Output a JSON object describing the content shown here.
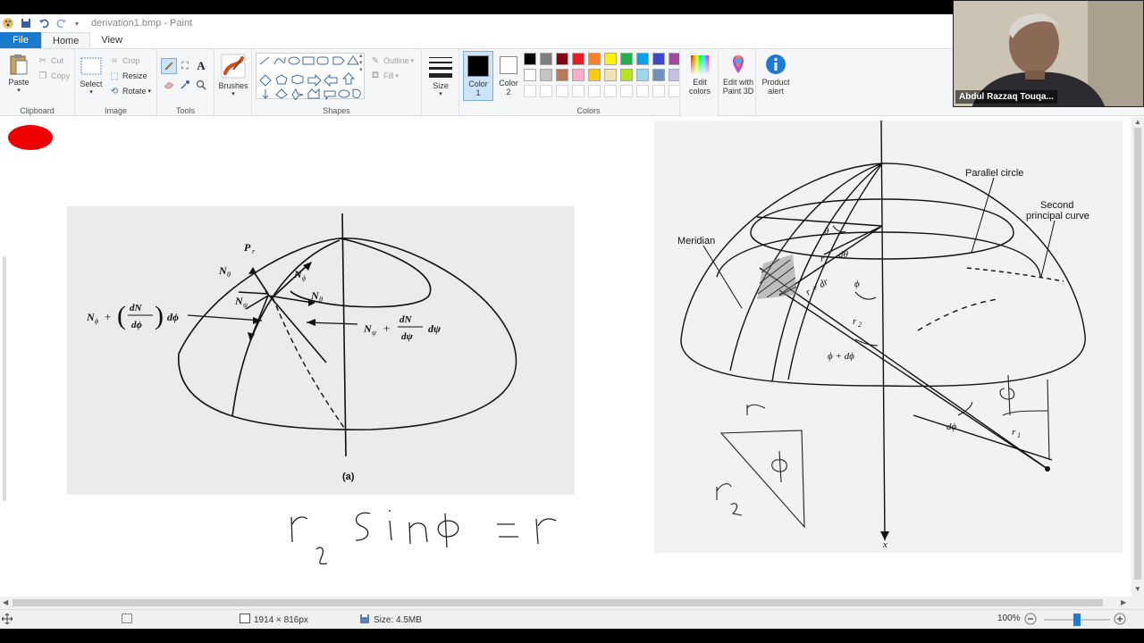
{
  "window": {
    "title": "derivation1.bmp - Paint"
  },
  "tabs": {
    "file": "File",
    "home": "Home",
    "view": "View"
  },
  "ribbon": {
    "clipboard": {
      "label": "Clipboard",
      "paste": "Paste",
      "cut": "Cut",
      "copy": "Copy"
    },
    "image": {
      "label": "Image",
      "select": "Select",
      "crop": "Crop",
      "resize": "Resize",
      "rotate": "Rotate"
    },
    "tools": {
      "label": "Tools"
    },
    "brushes": {
      "label": "Brushes"
    },
    "shapes": {
      "label": "Shapes",
      "outline": "Outline",
      "fill": "Fill"
    },
    "size": {
      "label": "Size"
    },
    "colors": {
      "label": "Colors",
      "color1": "Color 1",
      "color2": "Color 2",
      "edit_colors": "Edit colors",
      "palette_row1": [
        "#000000",
        "#7f7f7f",
        "#880015",
        "#ed1c24",
        "#ff7f27",
        "#fff200",
        "#22b14c",
        "#00a2e8",
        "#3f48cc",
        "#a349a4"
      ],
      "palette_row2": [
        "#ffffff",
        "#c3c3c3",
        "#b97a57",
        "#ffaec9",
        "#ffc90e",
        "#efe4b0",
        "#b5e61d",
        "#99d9ea",
        "#7092be",
        "#c8bfe7"
      ],
      "color1_value": "#000000",
      "color2_value": "#ffffff"
    },
    "paint3d": {
      "label": "Edit with Paint 3D"
    },
    "product_alert": {
      "label": "Product alert"
    }
  },
  "canvas": {
    "left_figure": {
      "labels": {
        "pr": "P",
        "pr_sub": "r",
        "ntheta_top": "N",
        "ntheta_sub": "θ",
        "nphi": "N",
        "nphi_sub": "ϕ",
        "ntheta2": "N",
        "ntheta2_sub": "θ",
        "npsi": "N",
        "npsi_sub": "ψ",
        "left_eq_a": "N",
        "left_eq_b": "+",
        "left_eq_num": "dN",
        "left_eq_den": "dϕ",
        "left_eq_tail": "dϕ",
        "right_eq_a": "N",
        "right_eq_b": "+",
        "right_eq_num": "dN",
        "right_eq_den": "dψ",
        "right_eq_tail": "dψ",
        "caption": "(a)"
      }
    },
    "right_figure": {
      "labels": {
        "parallel_circle": "Parallel circle",
        "second_principal_1": "Second",
        "second_principal_2": "principal curve",
        "meridian": "Meridian",
        "theta": "θ",
        "dtheta": "dθ",
        "r": "r",
        "r_dr": "r + dr",
        "phi": "ϕ",
        "r2": "r",
        "r2_sub": "2",
        "phi_dphi": "ϕ + dϕ",
        "dphi": "dϕ",
        "r1": "r",
        "r1_sub": "1",
        "x": "x"
      }
    }
  },
  "status": {
    "dimensions": "1914 × 816px",
    "size": "Size: 4.5MB",
    "zoom": "100%",
    "zoom_level": 0.5
  },
  "webcam": {
    "name": "Abdul Razzaq Touqa..."
  }
}
